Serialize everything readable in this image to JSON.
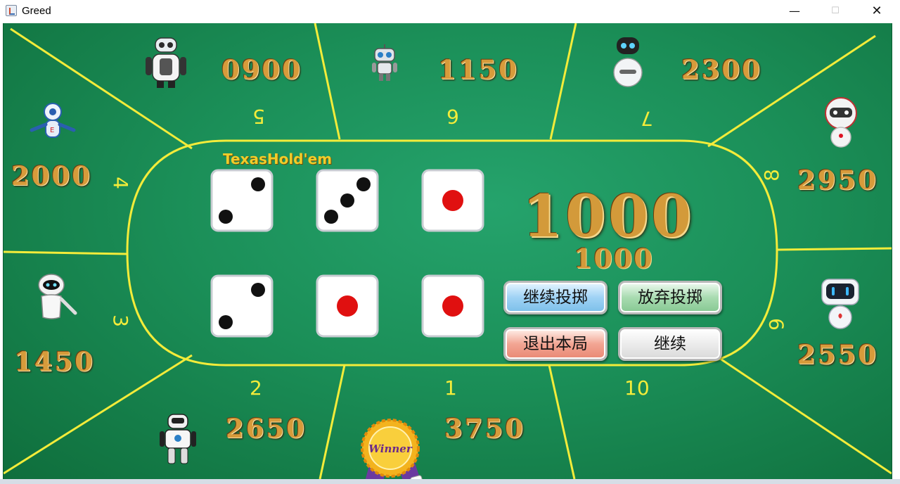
{
  "window": {
    "title": "Greed",
    "minimize_glyph": "—",
    "maximize_glyph": "☐",
    "close_glyph": "✕"
  },
  "colors": {
    "felt": "#1b8f58",
    "table_line": "#f3ec3a",
    "score_gold": "#d79b3b"
  },
  "table": {
    "brand": "TexasHold'em",
    "pot": "1000",
    "pot_sub": "1000"
  },
  "seats": [
    {
      "number": "1",
      "score": "3750",
      "avatar": "winner-badge-icon"
    },
    {
      "number": "2",
      "score": "2650",
      "avatar": "robot-icon"
    },
    {
      "number": "3",
      "score": "1450",
      "avatar": "robot-icon"
    },
    {
      "number": "4",
      "score": "2000",
      "avatar": "robot-icon"
    },
    {
      "number": "5",
      "score": "0900",
      "avatar": "robot-icon"
    },
    {
      "number": "6",
      "score": "1150",
      "avatar": "robot-icon"
    },
    {
      "number": "7",
      "score": "2300",
      "avatar": "robot-icon"
    },
    {
      "number": "8",
      "score": "2950",
      "avatar": "robot-icon"
    },
    {
      "number": "9",
      "score": "2550",
      "avatar": "robot-icon"
    },
    {
      "number": "10",
      "score": "",
      "avatar": ""
    }
  ],
  "dice": [
    2,
    3,
    1,
    2,
    1,
    1
  ],
  "buttons": {
    "roll": "继续投掷",
    "give_up": "放弃投掷",
    "quit": "退出本局",
    "continue": "继续"
  },
  "winner_badge": "Winner"
}
